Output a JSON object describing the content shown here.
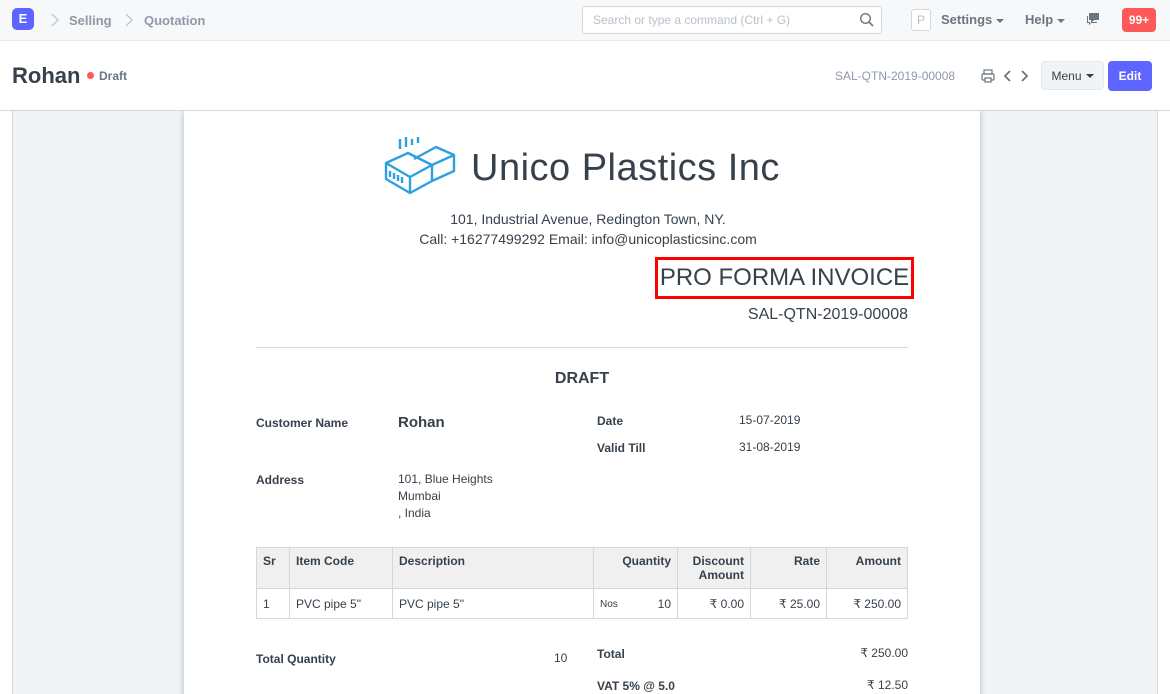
{
  "navbar": {
    "logo_letter": "E",
    "breadcrumbs": [
      "Selling",
      "Quotation"
    ],
    "search_placeholder": "Search or type a command (Ctrl + G)",
    "avatar_letter": "P",
    "settings_label": "Settings",
    "help_label": "Help",
    "notifications_count": "99+"
  },
  "page_head": {
    "title": "Rohan",
    "status": "Draft",
    "doc_name": "SAL-QTN-2019-00008",
    "menu_label": "Menu",
    "edit_label": "Edit"
  },
  "print": {
    "company_name": "Unico Plastics Inc",
    "address_line": "101, Industrial Avenue, Redington Town, NY.",
    "contact_line": "Call: +16277499292 Email: info@unicoplasticsinc.com",
    "doc_title": "PRO FORMA INVOICE",
    "doc_no": "SAL-QTN-2019-00008",
    "watermark": "DRAFT",
    "customer_label": "Customer Name",
    "customer_value": "Rohan",
    "date_label": "Date",
    "date_value": "15-07-2019",
    "valid_till_label": "Valid Till",
    "valid_till_value": "31-08-2019",
    "address_label": "Address",
    "address_lines": [
      "101, Blue Heights",
      "Mumbai",
      ", India"
    ],
    "table": {
      "headers": [
        "Sr",
        "Item Code",
        "Description",
        "Quantity",
        "Discount Amount",
        "Rate",
        "Amount"
      ],
      "rows": [
        {
          "sr": "1",
          "item_code": "PVC pipe 5\"",
          "description": "PVC pipe 5\"",
          "uom": "Nos",
          "qty": "10",
          "discount": "₹ 0.00",
          "rate": "₹ 25.00",
          "amount": "₹ 250.00"
        }
      ]
    },
    "total_qty_label": "Total Quantity",
    "total_qty_value": "10",
    "total_label": "Total",
    "total_value": "₹ 250.00",
    "vat_label": "VAT 5% @ 5.0",
    "vat_value": "₹ 12.50"
  },
  "colors": {
    "primary": "#5e64ff",
    "danger": "#ff5858",
    "highlight_border": "#ff0000",
    "logo_blue": "#2f9fe0"
  }
}
